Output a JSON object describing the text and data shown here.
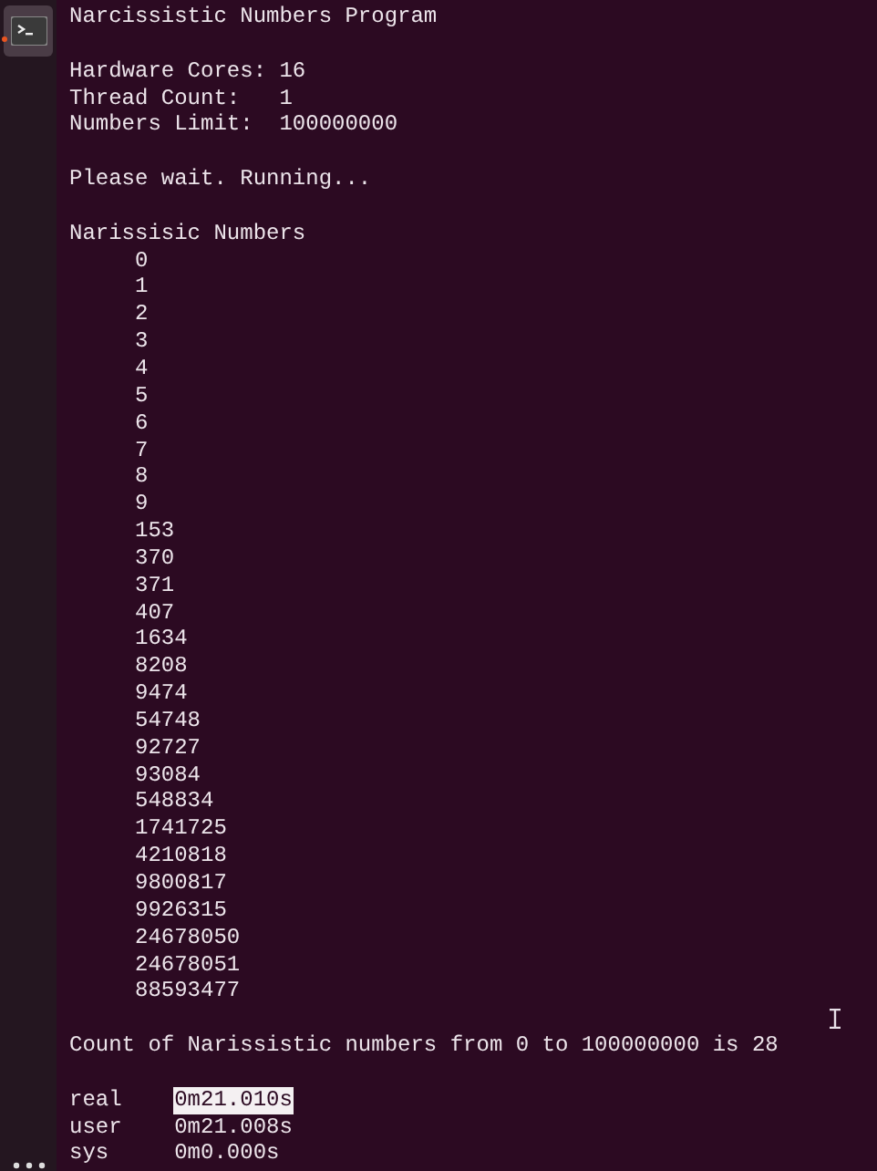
{
  "dock": {
    "items": [
      {
        "kind": "terminal",
        "selected": true
      },
      {
        "kind": "apps"
      }
    ]
  },
  "terminal": {
    "lines": [
      {
        "kind": "text",
        "text": "Narcissistic Numbers Program"
      },
      {
        "kind": "blank"
      },
      {
        "kind": "field",
        "label": "Hardware Cores:",
        "value": "16"
      },
      {
        "kind": "field",
        "label": "Thread Count:",
        "value": "1"
      },
      {
        "kind": "field",
        "label": "Numbers Limit:",
        "value": "100000000"
      },
      {
        "kind": "blank"
      },
      {
        "kind": "text",
        "text": "Please wait. Running..."
      },
      {
        "kind": "blank"
      },
      {
        "kind": "text",
        "text": "Narissisic Numbers"
      },
      {
        "kind": "number",
        "text": "0"
      },
      {
        "kind": "number",
        "text": "1"
      },
      {
        "kind": "number",
        "text": "2"
      },
      {
        "kind": "number",
        "text": "3"
      },
      {
        "kind": "number",
        "text": "4"
      },
      {
        "kind": "number",
        "text": "5"
      },
      {
        "kind": "number",
        "text": "6"
      },
      {
        "kind": "number",
        "text": "7"
      },
      {
        "kind": "number",
        "text": "8"
      },
      {
        "kind": "number",
        "text": "9"
      },
      {
        "kind": "number",
        "text": "153"
      },
      {
        "kind": "number",
        "text": "370"
      },
      {
        "kind": "number",
        "text": "371"
      },
      {
        "kind": "number",
        "text": "407"
      },
      {
        "kind": "number",
        "text": "1634"
      },
      {
        "kind": "number",
        "text": "8208"
      },
      {
        "kind": "number",
        "text": "9474"
      },
      {
        "kind": "number",
        "text": "54748"
      },
      {
        "kind": "number",
        "text": "92727"
      },
      {
        "kind": "number",
        "text": "93084"
      },
      {
        "kind": "number",
        "text": "548834"
      },
      {
        "kind": "number",
        "text": "1741725"
      },
      {
        "kind": "number",
        "text": "4210818"
      },
      {
        "kind": "number",
        "text": "9800817"
      },
      {
        "kind": "number",
        "text": "9926315"
      },
      {
        "kind": "number",
        "text": "24678050"
      },
      {
        "kind": "number",
        "text": "24678051"
      },
      {
        "kind": "number",
        "text": "88593477"
      },
      {
        "kind": "blank"
      },
      {
        "kind": "text",
        "text": "Count of Narissistic numbers from 0 to 100000000 is 28"
      },
      {
        "kind": "blank"
      },
      {
        "kind": "time",
        "label": "real",
        "value": "0m21.010s",
        "selected": true
      },
      {
        "kind": "time",
        "label": "user",
        "value": "0m21.008s",
        "selected": false
      },
      {
        "kind": "time",
        "label": "sys",
        "value": "0m0.000s",
        "selected": false
      }
    ]
  }
}
